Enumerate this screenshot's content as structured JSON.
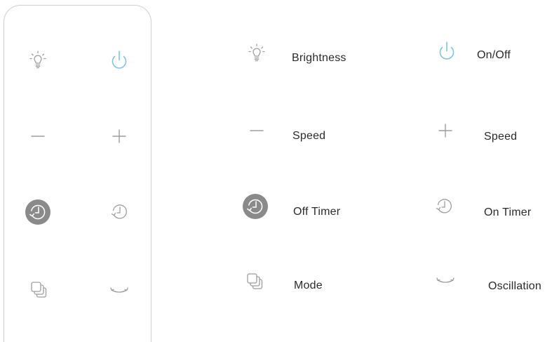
{
  "colors": {
    "icon_gray": "#9e9e9e",
    "accent_blue": "#7ec6e3",
    "timer_fill": "#8a8a8a",
    "text": "#2b2b2b"
  },
  "remote_buttons": [
    {
      "id": "brightness",
      "icon": "bulb-icon"
    },
    {
      "id": "power",
      "icon": "power-icon"
    },
    {
      "id": "speed-down",
      "icon": "minus-icon"
    },
    {
      "id": "speed-up",
      "icon": "plus-icon"
    },
    {
      "id": "off-timer",
      "icon": "off-timer-icon"
    },
    {
      "id": "on-timer",
      "icon": "on-timer-icon"
    },
    {
      "id": "mode",
      "icon": "mode-icon"
    },
    {
      "id": "oscillation",
      "icon": "oscillation-icon"
    }
  ],
  "legend": {
    "brightness": "Brightness",
    "on_off": "On/Off",
    "speed_down": "Speed",
    "speed_up": "Speed",
    "off_timer": "Off Timer",
    "on_timer": "On Timer",
    "mode": "Mode",
    "oscillation": "Oscillation"
  }
}
